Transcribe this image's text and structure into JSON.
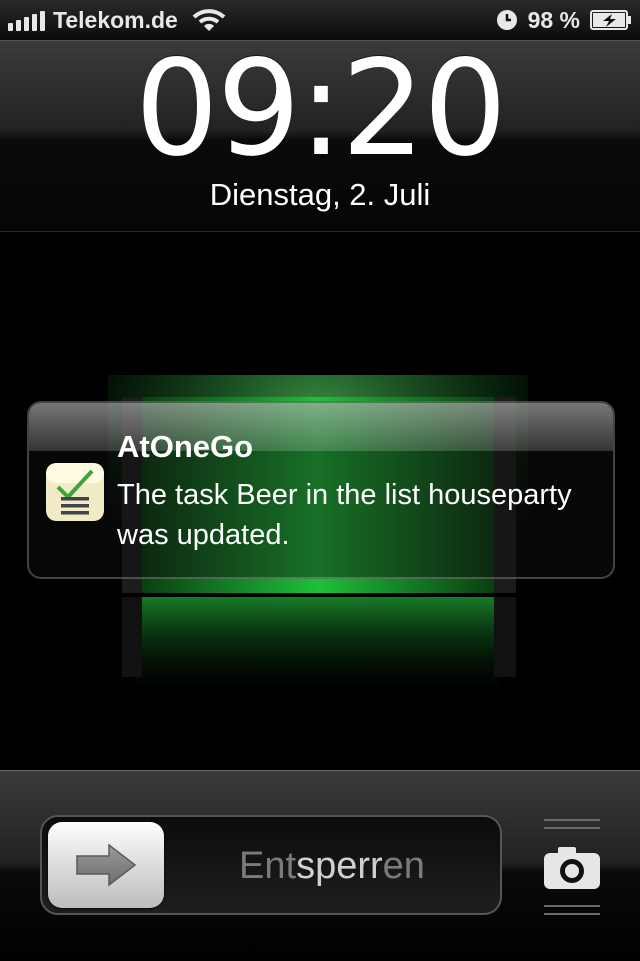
{
  "status_bar": {
    "carrier": "Telekom.de",
    "battery_percent": "98 %",
    "battery_level": 0.98,
    "icons": [
      "signal-bars-icon",
      "wifi-icon",
      "rotation-lock-icon",
      "battery-charging-icon"
    ]
  },
  "lock_screen": {
    "time": "09:20",
    "date": "Dienstag, 2. Juli"
  },
  "notification": {
    "app_name": "AtOneGo",
    "message": "The task Beer in the list houseparty was updated.",
    "icon": "checklist-app-icon"
  },
  "unlock": {
    "label_a": "Ent",
    "label_b": "sperr",
    "label_c": "en",
    "knob_icon": "arrow-right-icon",
    "camera_icon": "camera-icon"
  },
  "colors": {
    "charging_green": "#1fbf3a",
    "slider_text": "#7b7b7b"
  }
}
